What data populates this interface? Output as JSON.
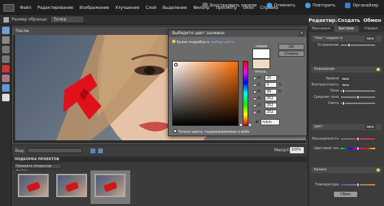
{
  "menubar": {
    "items": [
      "Файл",
      "Редактирование",
      "Изображение",
      "Улучшение",
      "Слой",
      "Выделение",
      "Фильтр",
      "Просмотр",
      "Окно",
      "Справка"
    ],
    "restore_panels": "Восстановить панели",
    "undo": "Отменить",
    "redo": "Повторить",
    "organizer": "Органайзер"
  },
  "options": {
    "sample_size_label": "Размер образца:",
    "sample_size_value": "Точка"
  },
  "document": {
    "title": "После"
  },
  "color_picker": {
    "title": "Выберите цвет заливки:",
    "hint": "Более подробно о:",
    "hint_link": "выбор цвета",
    "new_label": "новый",
    "current_label": "текущ.",
    "ok": "ОК",
    "cancel": "Отмена",
    "fields": [
      {
        "k": "H:",
        "v": "20",
        "u": "°"
      },
      {
        "k": "S:",
        "v": "0",
        "u": "%"
      },
      {
        "k": "B:",
        "v": "99",
        "u": "%"
      },
      {
        "k": "R:",
        "v": "252",
        "u": ""
      },
      {
        "k": "G:",
        "v": "252",
        "u": ""
      },
      {
        "k": "B:",
        "v": "252",
        "u": ""
      }
    ],
    "hex_label": "#",
    "hex_value": "fcfcfc",
    "web_only": "Только цвета, поддерживаемые в вебе",
    "new_color": "#fcfcfc",
    "current_color": "#f0dcc1"
  },
  "viewbar": {
    "view_label": "Вид:",
    "view_value": "",
    "zoom_label": "Масштаб:",
    "zoom_value": "100%"
  },
  "projectbin": {
    "header": "ПОДБОРКА ПРОЕКТОВ",
    "show_label": "Показать открытые файлы"
  },
  "rpanel": {
    "tabs": [
      "Редактир.",
      "Создать",
      "Обмен"
    ],
    "subtabs": [
      "Максимум",
      "Быстрое",
      "Управл."
    ],
    "smart_fix_header": "\"Умн.\" коррек-я",
    "smart_fix_btn": "Авто",
    "smart_fix_row": "Устранение",
    "lighting_header": "Освещение",
    "levels_label": "Уровни",
    "levels_btn": "Авто",
    "contrast_label": "Контрастность",
    "contrast_btn": "Авто",
    "shadows": "Тени",
    "midtones": "Средние тона",
    "highlights": "Света",
    "color_header": "Цвет",
    "color_btn": "Авто",
    "saturation": "Насыщенность",
    "hue": "Цветовой тон",
    "balance_header": "Баланс",
    "temperature": "Температура",
    "reset": "Сброс"
  }
}
